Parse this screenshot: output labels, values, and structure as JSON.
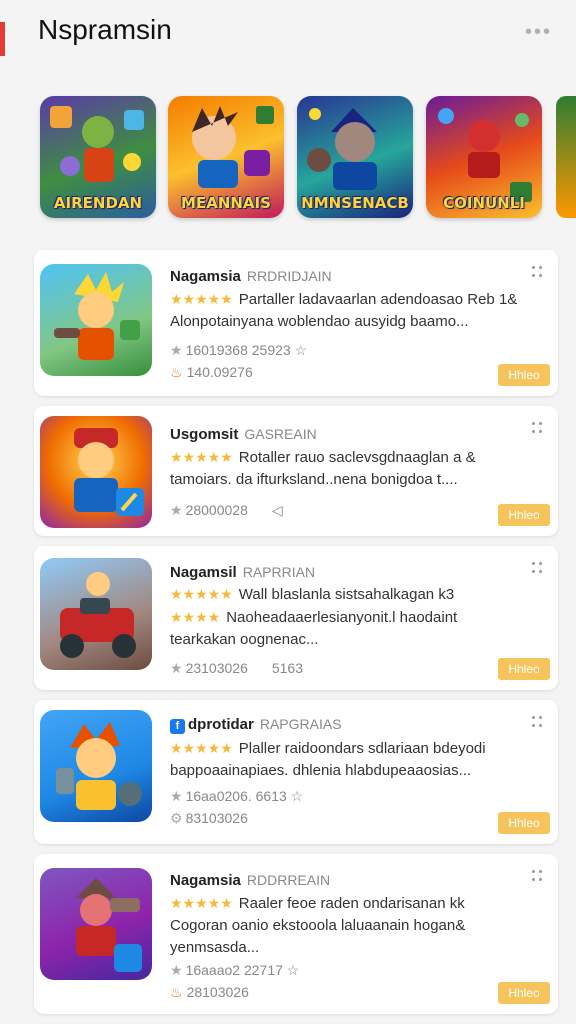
{
  "header": {
    "title": "Nspramsin",
    "menu_icon": "more-dots-icon"
  },
  "featured": [
    {
      "label": "AIRENDAN"
    },
    {
      "label": "MEANNAIS"
    },
    {
      "label": "NMNSENACB"
    },
    {
      "label": "COINUNLI"
    }
  ],
  "apps": [
    {
      "name": "Nagamsia",
      "category": "RRDRIDJAIN",
      "desc_line1": "Partaller ladavaarlan adendoasao Reb 1&",
      "desc_line2": "Alonpotainyana woblendao ausyidg baamo...",
      "desc_line3": "",
      "stat1": "16019368 25923 ☆",
      "stat2": "140.09276",
      "extra": "",
      "button": "Hhleo"
    },
    {
      "name": "Usgomsit",
      "category": "GASREAIN",
      "desc_line1": "Rotaller rauo saclevsgdnaaglan a &",
      "desc_line2": "tamoiars. da ifturksland..nena bonigdoa t....",
      "desc_line3": "",
      "stat1": "28000028",
      "stat2": "",
      "extra": "◁",
      "button": "Hhleo"
    },
    {
      "name": "Nagamsil",
      "category": "RAPRRIAN",
      "desc_line1": "Wall blaslanla sistsahalkagan k3",
      "desc_line2": "Naoheadaaerlesianyonit.l haodaint",
      "desc_line3": "tearkakan oognenac...",
      "stat1": "23103026",
      "stat2": "",
      "extra": "5163",
      "button": "Hhleo"
    },
    {
      "name": "dprotidar",
      "category": "RAPGRAIAS",
      "desc_line1": "Plaller raidoondars sdlariaan bdeyodi",
      "desc_line2": "bappoaainapiaes. dhlenia hlabdupeaaosias...",
      "desc_line3": "",
      "stat1": "16aa0206. 6613 ☆",
      "stat2": "83103026",
      "extra": "",
      "button": "Hhleo"
    },
    {
      "name": "Nagamsia",
      "category": "RDDRREAIN",
      "desc_line1": "Raaler feoe raden ondarisanan kk",
      "desc_line2": "Cogoran oanio ekstooola laluaanain hogan&",
      "desc_line3": "yenmsasda...",
      "stat1": "16aaao2 22717 ☆",
      "stat2": "28103026",
      "extra": "",
      "button": "Hhleo"
    }
  ]
}
